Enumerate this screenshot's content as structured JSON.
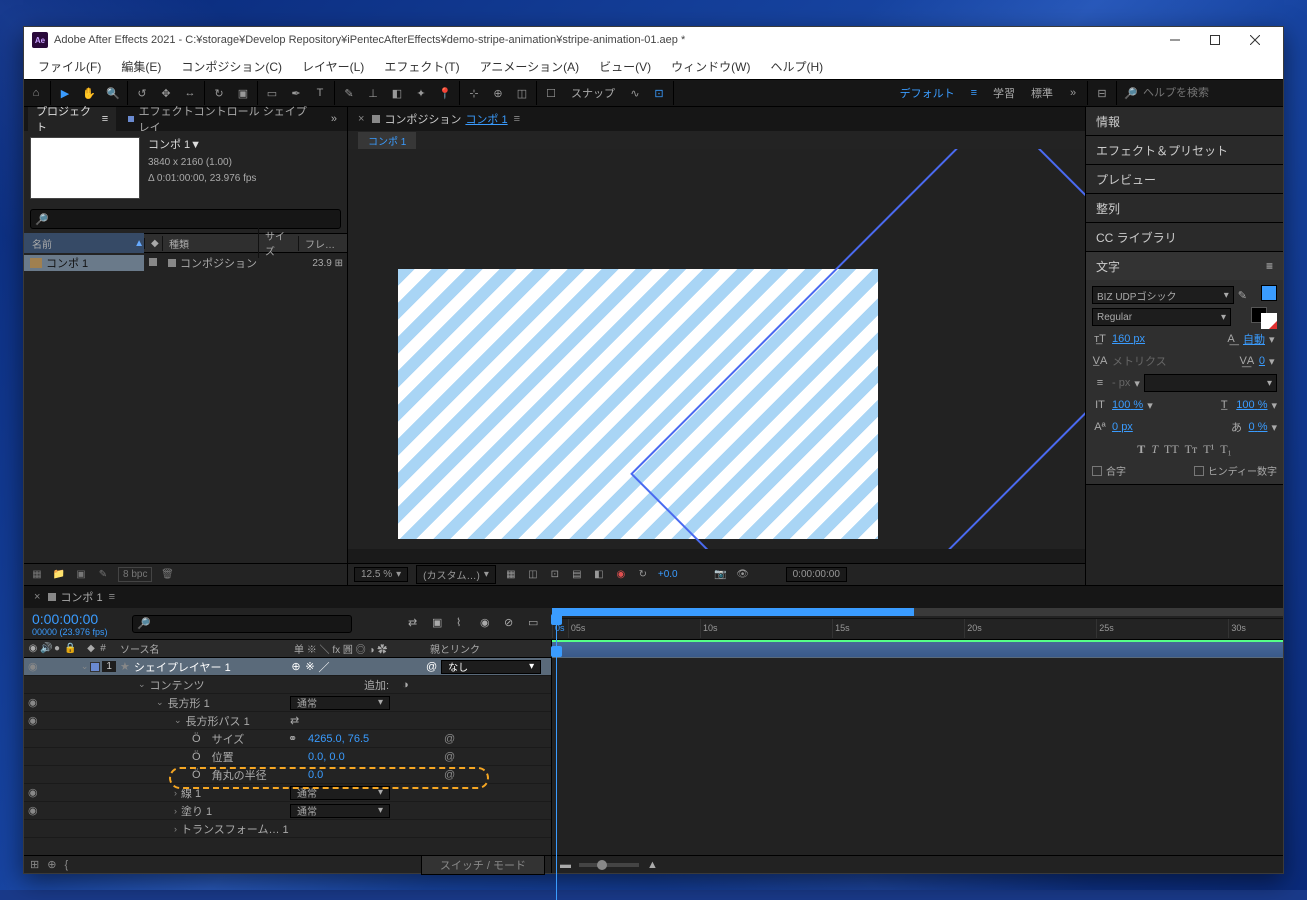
{
  "titlebar": {
    "app_icon": "Ae",
    "title": "Adobe After Effects 2021 - C:¥storage¥Develop Repository¥iPentecAfterEffects¥demo-stripe-animation¥stripe-animation-01.aep *"
  },
  "menu": [
    "ファイル(F)",
    "編集(E)",
    "コンポジション(C)",
    "レイヤー(L)",
    "エフェクト(T)",
    "アニメーション(A)",
    "ビュー(V)",
    "ウィンドウ(W)",
    "ヘルプ(H)"
  ],
  "toolbar": {
    "snap": "スナップ",
    "workspaces": [
      "デフォルト",
      "学習",
      "標準"
    ],
    "search_placeholder": "ヘルプを検索"
  },
  "project": {
    "tab_project": "プロジェクト",
    "tab_fx": "エフェクトコントロール シェイプレイ",
    "menu_glyph": "≡",
    "more_glyph": "»",
    "comp_title": "コンポ 1▼",
    "comp_dims": "3840 x 2160 (1.00)",
    "comp_dur": "Δ 0:01:00:00, 23.976 fps",
    "cols": {
      "name": "名前",
      "type": "種類",
      "size": "サイズ",
      "fps": "フレ…"
    },
    "row": {
      "name": "コンポ 1",
      "type": "コンポジション",
      "fps": "23.9"
    },
    "foot_bpc": "8 bpc"
  },
  "viewer": {
    "tab_label": "コンポジション",
    "tab_link": "コンポ 1",
    "chip": "コンポ 1",
    "zoom": "12.5 %",
    "res": "(カスタム…)",
    "exposure": "+0.0",
    "timecode": "0:00:00:00"
  },
  "right_panels": {
    "items": [
      "情報",
      "エフェクト＆プリセット",
      "プレビュー",
      "整列",
      "CC ライブラリ"
    ],
    "char_title": "文字",
    "char": {
      "font": "BIZ UDPゴシック",
      "style": "Regular",
      "size": "160",
      "size_unit": "px",
      "leading": "自動",
      "tracking_label": "メトリクス",
      "tracking": "0",
      "stroke": "- px",
      "hscale": "100",
      "hscale_unit": "%",
      "vscale": "100",
      "vscale_unit": "%",
      "baseline": "0",
      "baseline_unit": "px",
      "tsume": "0",
      "tsume_unit": "%",
      "ligature": "合字",
      "hindi": "ヒンディー数字"
    }
  },
  "timeline": {
    "tab": "コンポ 1",
    "timecode": "0:00:00:00",
    "frameinfo": "00000 (23.976 fps)",
    "cols": {
      "source": "ソース名",
      "switches": "单 ※ ＼ fx 圓 ◎ ◑ ✿",
      "parent": "親とリンク",
      "num": "#"
    },
    "ticks": [
      "0s",
      "05s",
      "10s",
      "15s",
      "20s",
      "25s",
      "30s"
    ],
    "layer": {
      "name": "シェイプレイヤー 1",
      "parent": "なし",
      "contents": "コンテンツ",
      "add": "追加:",
      "rect1": "長方形 1",
      "mode_normal": "通常",
      "rectpath": "長方形パス 1",
      "size_label": "サイズ",
      "size_value": "4265.0, 76.5",
      "pos_label": "位置",
      "pos_value": "0.0, 0.0",
      "radius_label": "角丸の半径",
      "radius_value": "0.0",
      "stroke": "線 1",
      "fill": "塗り 1",
      "transform": "トランスフォーム… 1"
    },
    "foot_btn": "スイッチ / モード"
  }
}
